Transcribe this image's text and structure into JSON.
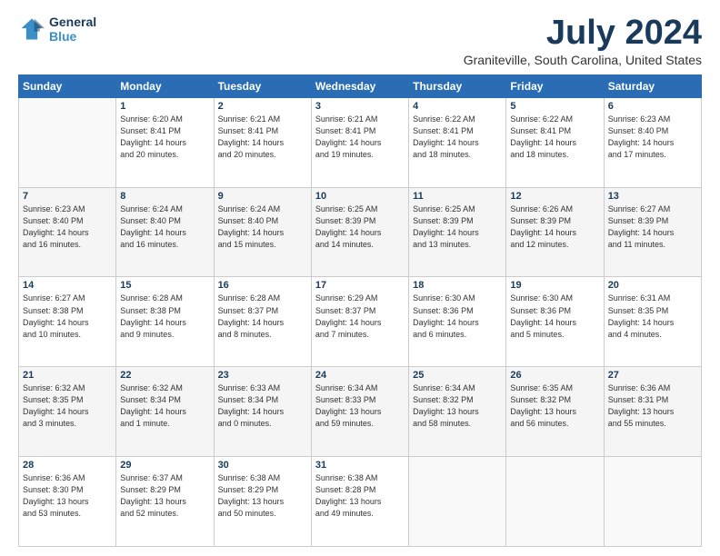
{
  "logo": {
    "line1": "General",
    "line2": "Blue"
  },
  "title": "July 2024",
  "subtitle": "Graniteville, South Carolina, United States",
  "header_days": [
    "Sunday",
    "Monday",
    "Tuesday",
    "Wednesday",
    "Thursday",
    "Friday",
    "Saturday"
  ],
  "weeks": [
    [
      {
        "day": "",
        "info": ""
      },
      {
        "day": "1",
        "info": "Sunrise: 6:20 AM\nSunset: 8:41 PM\nDaylight: 14 hours\nand 20 minutes."
      },
      {
        "day": "2",
        "info": "Sunrise: 6:21 AM\nSunset: 8:41 PM\nDaylight: 14 hours\nand 20 minutes."
      },
      {
        "day": "3",
        "info": "Sunrise: 6:21 AM\nSunset: 8:41 PM\nDaylight: 14 hours\nand 19 minutes."
      },
      {
        "day": "4",
        "info": "Sunrise: 6:22 AM\nSunset: 8:41 PM\nDaylight: 14 hours\nand 18 minutes."
      },
      {
        "day": "5",
        "info": "Sunrise: 6:22 AM\nSunset: 8:41 PM\nDaylight: 14 hours\nand 18 minutes."
      },
      {
        "day": "6",
        "info": "Sunrise: 6:23 AM\nSunset: 8:40 PM\nDaylight: 14 hours\nand 17 minutes."
      }
    ],
    [
      {
        "day": "7",
        "info": "Sunrise: 6:23 AM\nSunset: 8:40 PM\nDaylight: 14 hours\nand 16 minutes."
      },
      {
        "day": "8",
        "info": "Sunrise: 6:24 AM\nSunset: 8:40 PM\nDaylight: 14 hours\nand 16 minutes."
      },
      {
        "day": "9",
        "info": "Sunrise: 6:24 AM\nSunset: 8:40 PM\nDaylight: 14 hours\nand 15 minutes."
      },
      {
        "day": "10",
        "info": "Sunrise: 6:25 AM\nSunset: 8:39 PM\nDaylight: 14 hours\nand 14 minutes."
      },
      {
        "day": "11",
        "info": "Sunrise: 6:25 AM\nSunset: 8:39 PM\nDaylight: 14 hours\nand 13 minutes."
      },
      {
        "day": "12",
        "info": "Sunrise: 6:26 AM\nSunset: 8:39 PM\nDaylight: 14 hours\nand 12 minutes."
      },
      {
        "day": "13",
        "info": "Sunrise: 6:27 AM\nSunset: 8:39 PM\nDaylight: 14 hours\nand 11 minutes."
      }
    ],
    [
      {
        "day": "14",
        "info": "Sunrise: 6:27 AM\nSunset: 8:38 PM\nDaylight: 14 hours\nand 10 minutes."
      },
      {
        "day": "15",
        "info": "Sunrise: 6:28 AM\nSunset: 8:38 PM\nDaylight: 14 hours\nand 9 minutes."
      },
      {
        "day": "16",
        "info": "Sunrise: 6:28 AM\nSunset: 8:37 PM\nDaylight: 14 hours\nand 8 minutes."
      },
      {
        "day": "17",
        "info": "Sunrise: 6:29 AM\nSunset: 8:37 PM\nDaylight: 14 hours\nand 7 minutes."
      },
      {
        "day": "18",
        "info": "Sunrise: 6:30 AM\nSunset: 8:36 PM\nDaylight: 14 hours\nand 6 minutes."
      },
      {
        "day": "19",
        "info": "Sunrise: 6:30 AM\nSunset: 8:36 PM\nDaylight: 14 hours\nand 5 minutes."
      },
      {
        "day": "20",
        "info": "Sunrise: 6:31 AM\nSunset: 8:35 PM\nDaylight: 14 hours\nand 4 minutes."
      }
    ],
    [
      {
        "day": "21",
        "info": "Sunrise: 6:32 AM\nSunset: 8:35 PM\nDaylight: 14 hours\nand 3 minutes."
      },
      {
        "day": "22",
        "info": "Sunrise: 6:32 AM\nSunset: 8:34 PM\nDaylight: 14 hours\nand 1 minute."
      },
      {
        "day": "23",
        "info": "Sunrise: 6:33 AM\nSunset: 8:34 PM\nDaylight: 14 hours\nand 0 minutes."
      },
      {
        "day": "24",
        "info": "Sunrise: 6:34 AM\nSunset: 8:33 PM\nDaylight: 13 hours\nand 59 minutes."
      },
      {
        "day": "25",
        "info": "Sunrise: 6:34 AM\nSunset: 8:32 PM\nDaylight: 13 hours\nand 58 minutes."
      },
      {
        "day": "26",
        "info": "Sunrise: 6:35 AM\nSunset: 8:32 PM\nDaylight: 13 hours\nand 56 minutes."
      },
      {
        "day": "27",
        "info": "Sunrise: 6:36 AM\nSunset: 8:31 PM\nDaylight: 13 hours\nand 55 minutes."
      }
    ],
    [
      {
        "day": "28",
        "info": "Sunrise: 6:36 AM\nSunset: 8:30 PM\nDaylight: 13 hours\nand 53 minutes."
      },
      {
        "day": "29",
        "info": "Sunrise: 6:37 AM\nSunset: 8:29 PM\nDaylight: 13 hours\nand 52 minutes."
      },
      {
        "day": "30",
        "info": "Sunrise: 6:38 AM\nSunset: 8:29 PM\nDaylight: 13 hours\nand 50 minutes."
      },
      {
        "day": "31",
        "info": "Sunrise: 6:38 AM\nSunset: 8:28 PM\nDaylight: 13 hours\nand 49 minutes."
      },
      {
        "day": "",
        "info": ""
      },
      {
        "day": "",
        "info": ""
      },
      {
        "day": "",
        "info": ""
      }
    ]
  ]
}
